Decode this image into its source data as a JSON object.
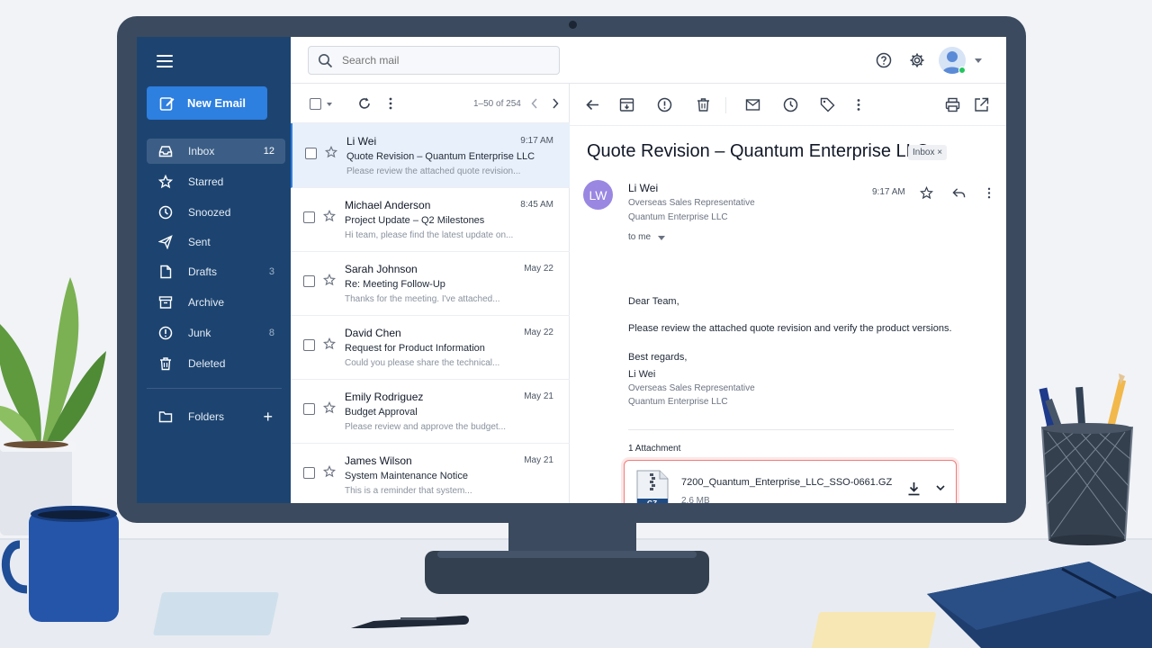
{
  "colors": {
    "sidebar_bg": "#1d4470",
    "accent_blue": "#2d7fe0",
    "selected_row_bg": "#e8f0fb",
    "attachment_highlight": "#ef7d7d",
    "avatar_lw": "#9a87e2"
  },
  "sidebar": {
    "menu_icon": "hamburger-icon",
    "new_email_label": "New Email",
    "items": [
      {
        "label": "Inbox",
        "count": "12",
        "icon": "inbox-icon",
        "active": true
      },
      {
        "label": "Starred",
        "count": "",
        "icon": "star-icon"
      },
      {
        "label": "Snoozed",
        "count": "",
        "icon": "clock-icon"
      },
      {
        "label": "Sent",
        "count": "",
        "icon": "send-icon"
      },
      {
        "label": "Drafts",
        "count": "3",
        "icon": "file-icon"
      },
      {
        "label": "Archive",
        "count": "",
        "icon": "archive-icon"
      },
      {
        "label": "Junk",
        "count": "8",
        "icon": "alert-icon"
      },
      {
        "label": "Deleted",
        "count": "",
        "icon": "trash-icon"
      }
    ],
    "folders_label": "Folders",
    "folders_add": "+"
  },
  "search": {
    "placeholder": "Search mail"
  },
  "list": {
    "pager": "1–50 of 254",
    "messages": [
      {
        "sender": "Li Wei",
        "time": "9:17 AM",
        "subject": "Quote Revision – Quantum Enterprise LLC",
        "preview": "Please review the attached quote revision...",
        "selected": true
      },
      {
        "sender": "Michael Anderson",
        "time": "8:45 AM",
        "subject": "Project Update – Q2 Milestones",
        "preview": "Hi team, please find the latest update on..."
      },
      {
        "sender": "Sarah Johnson",
        "time": "May 22",
        "subject": "Re: Meeting Follow-Up",
        "preview": "Thanks for the meeting. I've attached..."
      },
      {
        "sender": "David Chen",
        "time": "May 22",
        "subject": "Request for Product Information",
        "preview": "Could you please share the technical..."
      },
      {
        "sender": "Emily Rodriguez",
        "time": "May 21",
        "subject": "Budget Approval",
        "preview": "Please review and approve the budget..."
      },
      {
        "sender": "James Wilson",
        "time": "May 21",
        "subject": "System Maintenance Notice",
        "preview": "This is a reminder that system..."
      }
    ]
  },
  "reader": {
    "title": "Quote Revision – Quantum Enterprise LLC",
    "tag": "Inbox ×",
    "avatar_initials": "LW",
    "from_name": "Li Wei",
    "from_role": "Overseas Sales Representative",
    "from_company": "Quantum Enterprise LLC",
    "to": "to me",
    "time": "9:17 AM",
    "greeting": "Dear Team,",
    "body": "Please review the attached quote revision and verify the product versions.",
    "closing": "Best regards,",
    "sig_name": "Li Wei",
    "sig_role": "Overseas Sales Representative",
    "sig_company": "Quantum Enterprise LLC",
    "attachment_count_label": "1 Attachment",
    "attachment": {
      "name": "7200_Quantum_Enterprise_LLC_SSO-0661.GZ",
      "size": "2.6 MB",
      "type_badge": "GZ"
    }
  }
}
